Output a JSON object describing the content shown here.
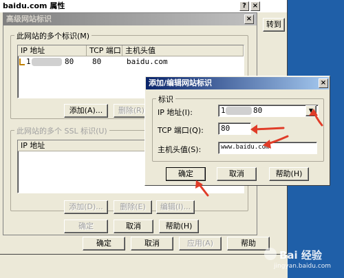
{
  "bg_window": {
    "title": "baidu.com 属性",
    "help_btn": "?",
    "close_btn": "×",
    "goto_label": "转到",
    "bottom_buttons": [
      "确定",
      "取消",
      "应用(A)",
      "帮助"
    ]
  },
  "advanced_dialog": {
    "title": "高级网站标识",
    "close_btn": "×",
    "group1_label": "此网站的多个标识(M)",
    "columns": [
      "IP 地址",
      "TCP 端口",
      "主机头值"
    ],
    "rows": [
      {
        "ip": "1",
        "ip_tail": "80",
        "port": "80",
        "host": "baidu.com"
      }
    ],
    "group1_buttons": [
      "添加(A)...",
      "删除(R)"
    ],
    "group2_label": "此网站的多个 SSL 标识(U)",
    "ssl_columns": [
      "IP 地址"
    ],
    "group2_buttons": [
      "添加(D)...",
      "删除(E)",
      "编辑(I)..."
    ],
    "bottom_buttons": [
      "确定",
      "取消",
      "帮助(H)"
    ]
  },
  "edit_dialog": {
    "title": "添加/编辑网站标识",
    "close_btn": "×",
    "group_label": "标识",
    "ip_label": "IP 地址(I):",
    "ip_value_head": "1",
    "ip_value_tail": "80",
    "port_label": "TCP 端口(Q):",
    "port_value": "80",
    "host_label": "主机头值(S):",
    "host_value": "www.baidu.com",
    "buttons": [
      "确定",
      "取消",
      "帮助(H)"
    ]
  },
  "watermark": {
    "text": "Bai 经验",
    "url": "jingyan.baidu.com"
  },
  "colors": {
    "desktop": "#1c5ea8",
    "arrow": "#e03c28",
    "active_title": "#0a246a"
  }
}
